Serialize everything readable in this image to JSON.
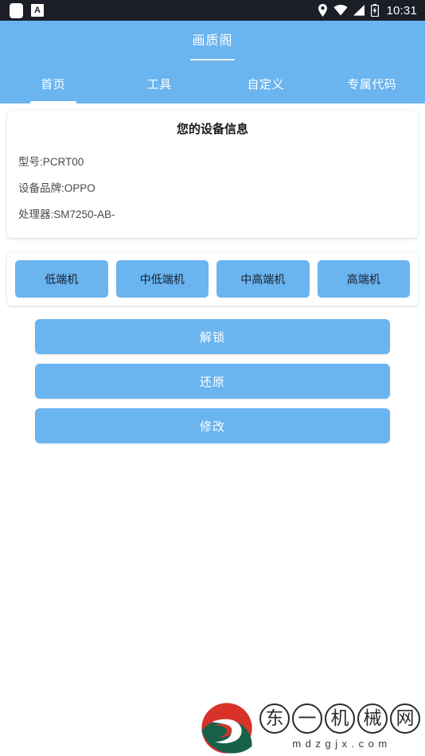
{
  "status_bar": {
    "left_icons": [
      "rounded-square-icon",
      "letter-a-badge-icon"
    ],
    "right_icons": [
      "location-pin-icon",
      "wifi-icon",
      "signal-icon",
      "battery-charging-icon"
    ],
    "time": "10:31",
    "background_color": "#1b1d27"
  },
  "header": {
    "title": "画质阁",
    "background_color": "#6ab4f0"
  },
  "tabs": [
    {
      "label": "首页",
      "active": true
    },
    {
      "label": "工具",
      "active": false
    },
    {
      "label": "自定义",
      "active": false
    },
    {
      "label": "专属代码",
      "active": false
    }
  ],
  "device_card": {
    "title": "您的设备信息",
    "lines": [
      "型号:PCRT00",
      "设备品牌:OPPO",
      "处理器:SM7250-AB-"
    ]
  },
  "tier_chips": [
    {
      "label": "低端机"
    },
    {
      "label": "中低端机"
    },
    {
      "label": "中高端机"
    },
    {
      "label": "高端机"
    }
  ],
  "actions": [
    {
      "label": "解锁"
    },
    {
      "label": "还原"
    },
    {
      "label": "修改"
    }
  ],
  "watermark": {
    "logo_name": "dongyi-logo-icon",
    "characters": [
      "东",
      "一",
      "机",
      "械",
      "网"
    ],
    "domain": "mdzgjx.com",
    "logo_red": "#d8322a",
    "logo_green": "#17614b"
  },
  "theme": {
    "accent": "#6ab4f0",
    "page_background": "#ffffff",
    "chip_text": "#17202b",
    "button_text": "#ffffff"
  }
}
